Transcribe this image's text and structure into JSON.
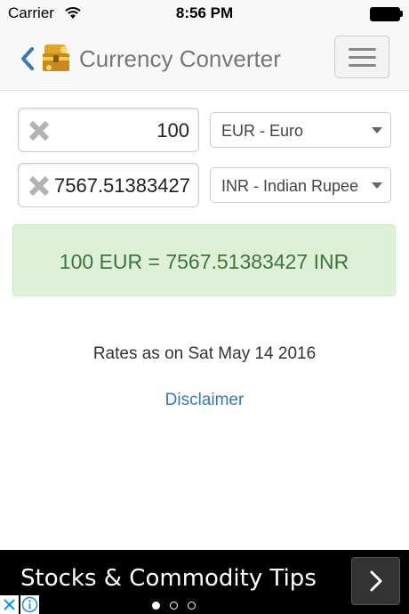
{
  "status_bar": {
    "carrier": "Carrier",
    "time": "8:56 PM",
    "icons": [
      "wifi-icon",
      "battery-icon"
    ]
  },
  "navbar": {
    "title": "Currency Converter",
    "icons": [
      "back-chevron-icon",
      "treasure-chest-icon",
      "hamburger-menu-icon"
    ]
  },
  "converter": {
    "from_amount": "100",
    "from_currency": "EUR - Euro",
    "to_amount": "7567.51383427",
    "to_currency": "INR - Indian Rupee",
    "result": "100 EUR = 7567.51383427 INR"
  },
  "rates_note": "Rates as on Sat May 14 2016",
  "disclaimer_link": "Disclaimer",
  "ad": {
    "text": "Stocks & Commodity Tips",
    "pager": {
      "count": 3,
      "active": 0
    }
  },
  "colors": {
    "accent": "#337ab7",
    "success_bg": "#dff0d8",
    "success_text": "#3c763d",
    "ad_bg": "#000000"
  }
}
